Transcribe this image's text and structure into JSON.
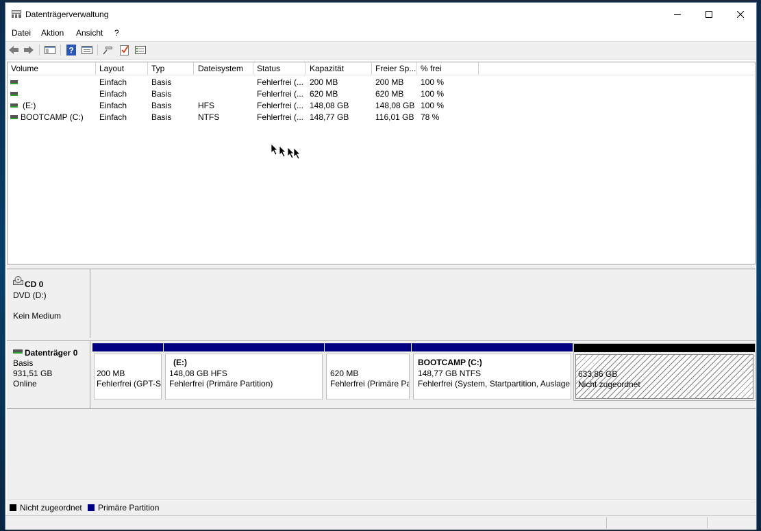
{
  "window": {
    "title": "Datenträgerverwaltung",
    "minimize_icon": "minimize-icon",
    "maximize_icon": "maximize-icon",
    "close_icon": "close-icon"
  },
  "menu": {
    "items": [
      "Datei",
      "Aktion",
      "Ansicht",
      "?"
    ]
  },
  "toolbar": {
    "buttons": [
      "back-arrow-icon",
      "forward-arrow-icon",
      "show-hide-console-tree-icon",
      "help-icon",
      "properties-icon",
      "connect-icon",
      "check-icon",
      "list-view-icon"
    ]
  },
  "volume_list": {
    "columns": [
      "Volume",
      "Layout",
      "Typ",
      "Dateisystem",
      "Status",
      "Kapazität",
      "Freier Sp...",
      "% frei"
    ],
    "rows": [
      {
        "volume": "",
        "layout": "Einfach",
        "typ": "Basis",
        "fs": "",
        "status": "Fehlerfrei (...",
        "cap": "200 MB",
        "free": "200 MB",
        "pct": "100 %"
      },
      {
        "volume": "",
        "layout": "Einfach",
        "typ": "Basis",
        "fs": "",
        "status": "Fehlerfrei (...",
        "cap": "620 MB",
        "free": "620 MB",
        "pct": "100 %"
      },
      {
        "volume": "(E:)",
        "layout": "Einfach",
        "typ": "Basis",
        "fs": "HFS",
        "status": "Fehlerfrei (...",
        "cap": "148,08 GB",
        "free": "148,08 GB",
        "pct": "100 %"
      },
      {
        "volume": "BOOTCAMP (C:)",
        "layout": "Einfach",
        "typ": "Basis",
        "fs": "NTFS",
        "status": "Fehlerfrei (...",
        "cap": "148,77 GB",
        "free": "116,01 GB",
        "pct": "78 %"
      }
    ]
  },
  "disks": {
    "cd0": {
      "name": "CD 0",
      "type": "DVD (D:)",
      "status": "Kein Medium"
    },
    "disk0": {
      "name": "Datenträger 0",
      "type": "Basis",
      "size": "931,51 GB",
      "status": "Online",
      "partitions": [
        {
          "title": "",
          "line1": "200 MB",
          "line2": "Fehlerfrei (GPT-S",
          "kind": "primary"
        },
        {
          "title": "(E:)",
          "line1": "148,08 GB HFS",
          "line2": "Fehlerfrei (Primäre Partition)",
          "kind": "primary"
        },
        {
          "title": "",
          "line1": "620 MB",
          "line2": "Fehlerfrei (Primäre Pa",
          "kind": "primary"
        },
        {
          "title": "BOOTCAMP  (C:)",
          "line1": "148,77 GB NTFS",
          "line2": "Fehlerfrei (System, Startpartition, Auslager",
          "kind": "primary"
        },
        {
          "title": "",
          "line1": "633,86 GB",
          "line2": "Nicht zugeordnet",
          "kind": "unallocated"
        }
      ]
    }
  },
  "legend": {
    "unallocated": "Nicht zugeordnet",
    "primary": "Primäre Partition"
  },
  "colors": {
    "primary_bar": "#000080",
    "unallocated_bar": "#000000"
  }
}
